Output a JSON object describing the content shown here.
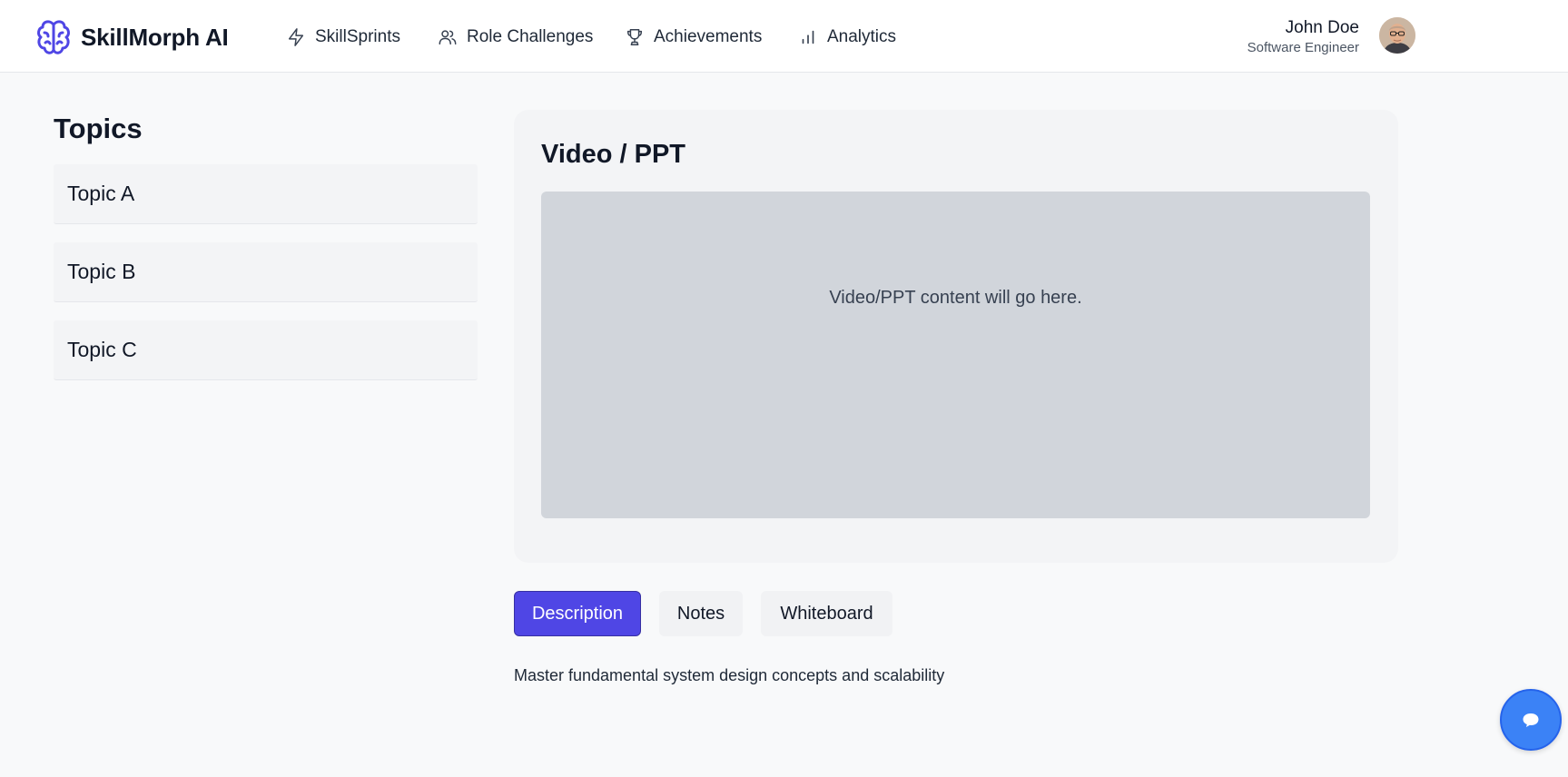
{
  "brand": {
    "name": "SkillMorph AI",
    "logo_icon": "brain-icon",
    "accent": "#4f46e5"
  },
  "nav": {
    "items": [
      {
        "label": "SkillSprints",
        "icon": "lightning-icon"
      },
      {
        "label": "Role Challenges",
        "icon": "users-icon"
      },
      {
        "label": "Achievements",
        "icon": "trophy-icon"
      },
      {
        "label": "Analytics",
        "icon": "bar-chart-icon"
      }
    ]
  },
  "user": {
    "name": "John Doe",
    "role": "Software Engineer"
  },
  "sidebar": {
    "title": "Topics",
    "topics": [
      {
        "label": "Topic A"
      },
      {
        "label": "Topic B"
      },
      {
        "label": "Topic C"
      }
    ]
  },
  "media": {
    "title": "Video / PPT",
    "placeholder": "Video/PPT content will go here."
  },
  "tabs": {
    "items": [
      {
        "label": "Description",
        "active": true
      },
      {
        "label": "Notes",
        "active": false
      },
      {
        "label": "Whiteboard",
        "active": false
      }
    ]
  },
  "content": {
    "description": "Master fundamental system design concepts and scalability"
  },
  "chat": {
    "icon": "chat-bubble-icon",
    "color": "#3b82f6"
  }
}
